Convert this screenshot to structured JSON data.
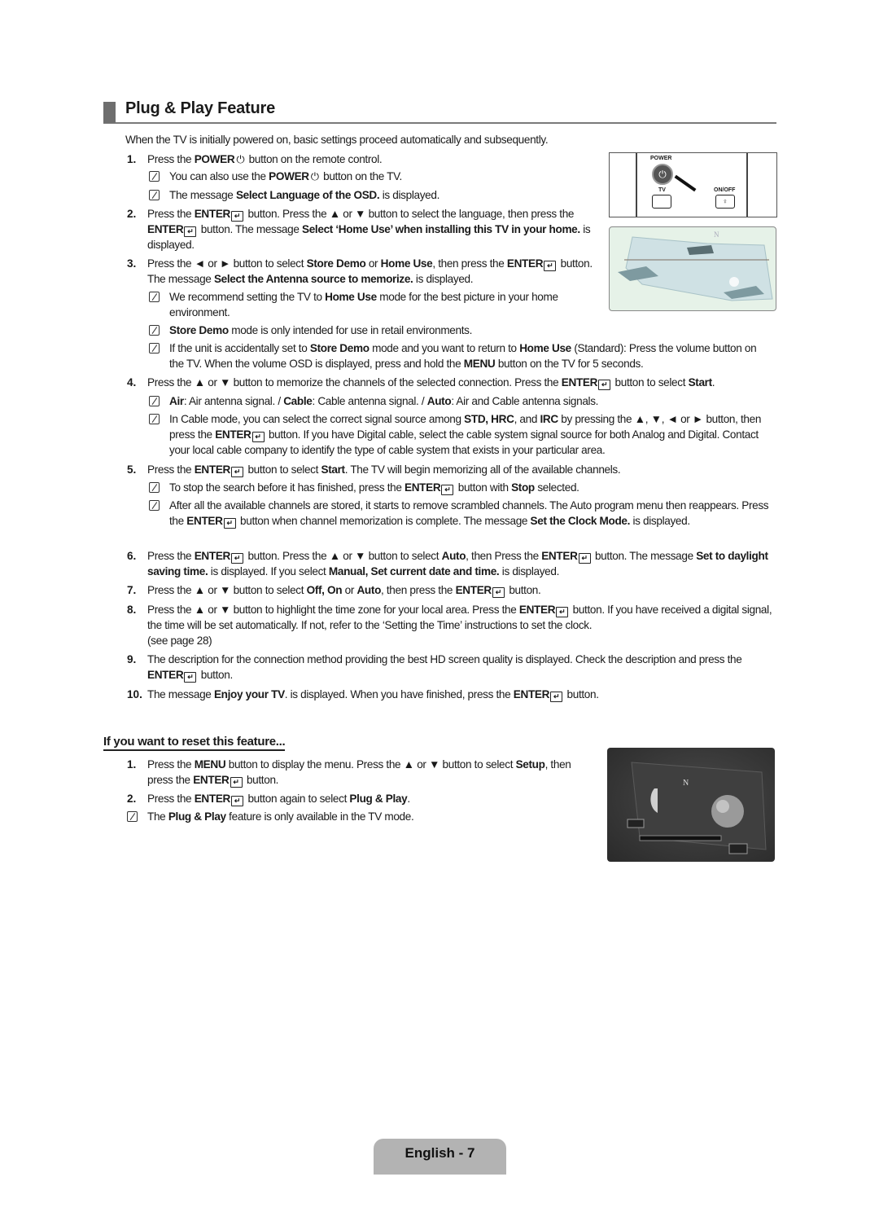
{
  "section": {
    "title": "Plug & Play Feature",
    "intro": "When the TV is initially powered on, basic settings proceed automatically and subsequently."
  },
  "steps": [
    {
      "num": "1.",
      "html": "Press the <b>POWER</b><span class='pw'>⏻</span> button on the remote control."
    },
    {
      "num": "2.",
      "html": "Press the <b>ENTER</b><span class='enter'>↵</span> button. Press the ▲ or ▼ button to select the language, then press the <b>ENTER</b><span class='enter'>↵</span> button. The message <b>Select ‘Home Use’ when installing this TV in your home.</b> is displayed."
    },
    {
      "num": "3.",
      "html": "Press the ◄ or ► button to select <b>Store Demo</b> or <b>Home Use</b>, then press the <b>ENTER</b><span class='enter'>↵</span> button. The message <b>Select the Antenna source to memorize.</b> is displayed."
    },
    {
      "num": "4.",
      "html": "Press the ▲ or ▼ button to memorize the channels of the selected connection. Press the <b>ENTER</b><span class='enter'>↵</span> button to select <b>Start</b>."
    },
    {
      "num": "5.",
      "html": "Press the <b>ENTER</b><span class='enter'>↵</span> button to select <b>Start</b>. The TV will begin memorizing all of the available channels."
    },
    {
      "num": "6.",
      "html": "Press the <b>ENTER</b><span class='enter'>↵</span> button. Press the ▲ or ▼ button to select <b>Auto</b>, then Press the <b>ENTER</b><span class='enter'>↵</span> button. The message <b>Set to daylight saving time.</b> is displayed. If you select <b>Manual, Set current date and time.</b> is displayed."
    },
    {
      "num": "7.",
      "html": "Press the ▲ or ▼ button to select <b>Off, On</b> or <b>Auto</b>, then press the <b>ENTER</b><span class='enter'>↵</span> button."
    },
    {
      "num": "8.",
      "html": "Press the ▲ or ▼ button to highlight the time zone for your local area. Press the <b>ENTER</b><span class='enter'>↵</span> button. If you have received a digital signal, the time will be set automatically. If not, refer to the ‘Setting the Time’ instructions to set the clock.<br>(see page 28)"
    },
    {
      "num": "9.",
      "html": "The description for the connection method providing the best HD screen quality is displayed. Check the description and press the <b>ENTER</b><span class='enter'>↵</span> button."
    },
    {
      "num": "10.",
      "html": "The message <b>Enjoy your TV</b>. is displayed. When you have finished, press the <b>ENTER</b><span class='enter'>↵</span> button."
    }
  ],
  "notes": {
    "s1a": "You can also use the <b>POWER</b><span class='pw'>⏻</span> button on the TV.",
    "s1b": "The message <b>Select Language of the OSD.</b> is displayed.",
    "s3a": "We recommend setting the TV to <b>Home Use</b> mode for the best picture in your home environment.",
    "s3b": "<b>Store Demo</b> mode is only intended for use in retail environments.",
    "s3c": "If the unit is accidentally set to <b>Store Demo</b> mode and you want to return to <b>Home Use</b> (Standard): Press the volume button on the TV. When the volume OSD is displayed, press and hold the <b>MENU</b> button on the TV for 5 seconds.",
    "s4a": "<b>Air</b>: Air antenna signal. / <b>Cable</b>: Cable antenna signal. / <b>Auto</b>: Air and Cable antenna signals.",
    "s4b": "In Cable mode, you can select the correct signal source among <b>STD, HRC</b>, and <b>IRC</b> by pressing the ▲, ▼, ◄ or ► button, then press the <b>ENTER</b><span class='enter'>↵</span> button. If you have Digital cable, select the cable system signal source for both Analog and Digital. Contact your local cable company to identify the type of cable system that exists in your particular area.",
    "s5a": "To stop the search before it has finished, press the <b>ENTER</b><span class='enter'>↵</span> button with <b>Stop</b> selected.",
    "s5b": "After all the available channels are stored, it starts to remove scrambled channels. The Auto program menu then reappears. Press the <b>ENTER</b><span class='enter'>↵</span> button when channel memorization is complete. The message <b>Set the Clock Mode.</b> is displayed."
  },
  "remote_image": {
    "power_label": "POWER",
    "tv_label": "TV",
    "onoff_label": "ON/OFF"
  },
  "reset": {
    "heading": "If you want to reset this feature...",
    "steps": [
      {
        "num": "1.",
        "html": "Press the <b>MENU</b> button to display the menu. Press the ▲ or ▼ button to select <b>Setup</b>, then press the <b>ENTER</b><span class='enter'>↵</span> button."
      },
      {
        "num": "2.",
        "html": "Press the <b>ENTER</b><span class='enter'>↵</span> button again to select <b>Plug &amp; Play</b>."
      }
    ],
    "note": "The <b>Plug &amp; Play</b> feature is only available in the TV mode."
  },
  "footer": {
    "page_label": "English - 7"
  }
}
